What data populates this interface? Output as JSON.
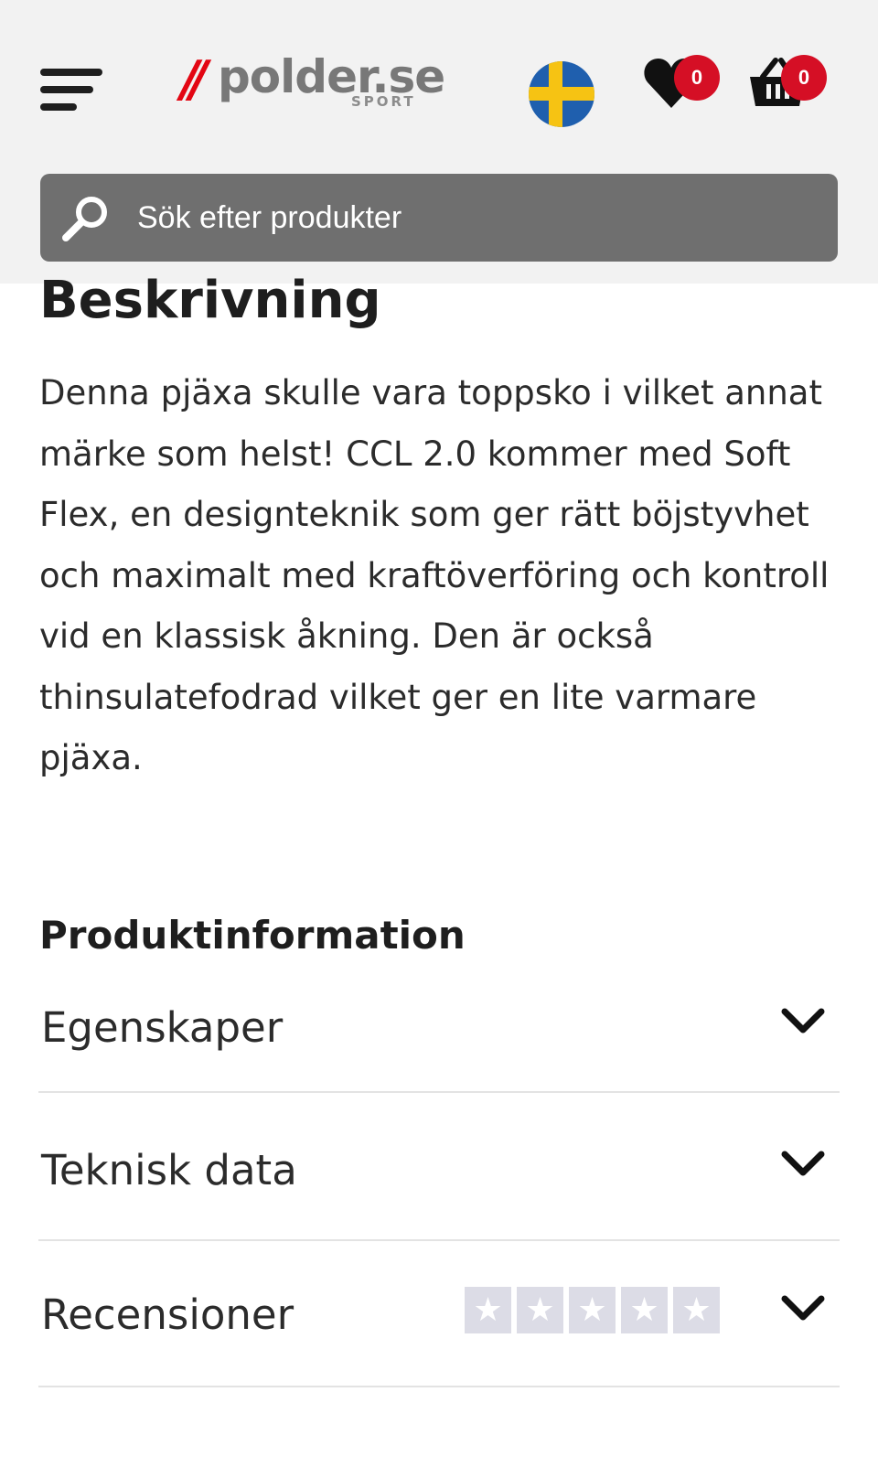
{
  "header": {
    "menu_icon": "hamburger-menu-icon",
    "logo": {
      "slashes": "//",
      "word": "polder.se",
      "sub": "SPORT"
    },
    "flag_icon": "sweden-flag-icon",
    "wishlist": {
      "icon": "heart-icon",
      "count": "0"
    },
    "cart": {
      "icon": "basket-icon",
      "count": "0"
    },
    "search": {
      "icon": "search-icon",
      "placeholder": "Sök efter produkter"
    },
    "colors": {
      "background": "#f2f2f2",
      "search_bg": "#6f6f6f",
      "badge": "#d50f25",
      "logo_red": "#e30613"
    }
  },
  "description": {
    "title": "Beskrivning",
    "text": "Denna pjäxa skulle vara toppsko i vilket annat märke som helst! CCL 2.0 kommer med Soft Flex, en designteknik som ger rätt böjstyvhet och maximalt med kraftöverföring och kontroll vid en klassisk åkning. Den är också thinsulatefodrad vilket ger en lite varmare pjäxa."
  },
  "product_info": {
    "title": "Produktinformation",
    "sections": [
      {
        "label": "Egenskaper",
        "icon": "chevron-down-icon"
      },
      {
        "label": "Teknisk data",
        "icon": "chevron-down-icon"
      },
      {
        "label": "Recensioner",
        "icon": "chevron-down-icon",
        "rating": {
          "filled": 0,
          "max": 5,
          "star_char": "★"
        }
      }
    ]
  }
}
